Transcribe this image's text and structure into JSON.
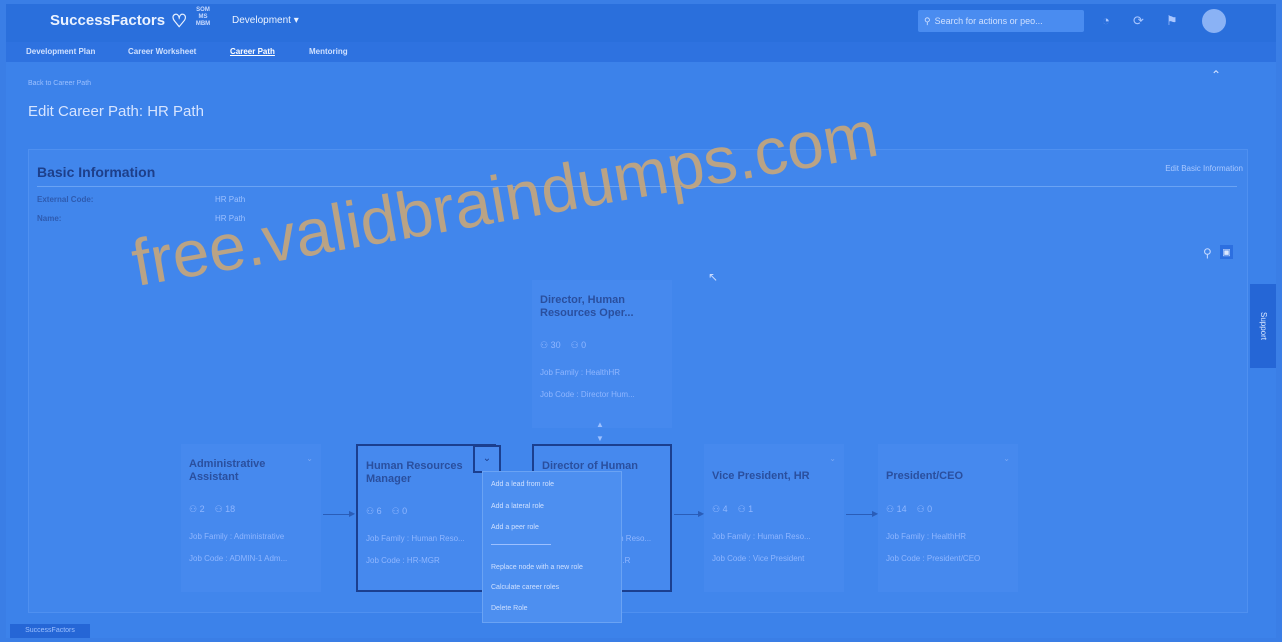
{
  "app": {
    "brand": "SuccessFactors",
    "brand_mark": "SOM MS MBM",
    "module": "Development ▾",
    "search_placeholder": "Search for actions or peo..."
  },
  "subnav": {
    "tabs": [
      "Development Plan",
      "Career Worksheet",
      "Career Path",
      "Mentoring"
    ],
    "active": "Career Path"
  },
  "page": {
    "back_link": "Back to Career Path",
    "title": "Edit Career Path: HR Path"
  },
  "basic_info": {
    "title": "Basic Information",
    "edit_link": "Edit Basic Information",
    "fields": [
      {
        "label": "External Code:",
        "value": "HR Path"
      },
      {
        "label": "Name:",
        "value": "HR Path"
      }
    ]
  },
  "roles": {
    "director_ops": {
      "title": "Director, Human Resources Oper...",
      "m1": "30",
      "m2": "0",
      "family": "Job Family : HealthHR",
      "code": "Job Code : Director Hum..."
    },
    "admin": {
      "title": "Administrative Assistant",
      "m1": "2",
      "m2": "18",
      "family": "Job Family : Administrative",
      "code": "Job Code : ADMIN-1 Adm..."
    },
    "hr_manager": {
      "title": "Human Resources Manager",
      "m1": "6",
      "m2": "0",
      "family": "Job Family : Human Reso...",
      "code": "Job Code : HR-MGR"
    },
    "director_hr": {
      "title": "Director of Human",
      "family": "...an Reso...",
      "code": "...R"
    },
    "vp_hr": {
      "title": "Vice President, HR",
      "m1": "4",
      "m2": "1",
      "family": "Job Family : Human Reso...",
      "code": "Job Code : Vice President"
    },
    "president": {
      "title": "President/CEO",
      "m1": "14",
      "m2": "0",
      "family": "Job Family : HealthHR",
      "code": "Job Code : President/CEO"
    }
  },
  "context_menu": {
    "items": [
      "Add a lead from role",
      "Add a lateral role",
      "Add a peer role",
      "Replace node with a new role",
      "Calculate career roles",
      "Delete Role"
    ]
  },
  "support_tab": "Support",
  "status_chip": "SuccessFactors",
  "watermark": "free.validbraindumps.com",
  "colors": {
    "overlay_blue": "#3c82ea",
    "title_blue": "#1d3f8a",
    "watermark": "#c8a77a"
  }
}
